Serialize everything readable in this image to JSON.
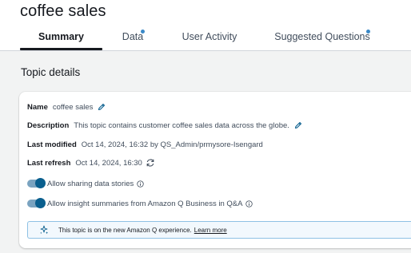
{
  "page": {
    "title": "coffee sales"
  },
  "tabs": [
    {
      "label": "Summary",
      "active": true,
      "indicator": false
    },
    {
      "label": "Data",
      "active": false,
      "indicator": true
    },
    {
      "label": "User Activity",
      "active": false,
      "indicator": false
    },
    {
      "label": "Suggested Questions",
      "active": false,
      "indicator": true
    }
  ],
  "topic_details": {
    "heading": "Topic details",
    "name_label": "Name",
    "name_value": "coffee sales",
    "description_label": "Description",
    "description_value": "This topic contains customer coffee sales data across the globe.",
    "last_modified_label": "Last modified",
    "last_modified_value": "Oct 14, 2024, 16:32 by QS_Admin/prmysore-Isengard",
    "last_refresh_label": "Last refresh",
    "last_refresh_value": "Oct 14, 2024, 16:30",
    "toggles": [
      {
        "label": "Allow sharing data stories",
        "on": true
      },
      {
        "label": "Allow insight summaries from Amazon Q Business in Q&A",
        "on": true
      }
    ],
    "banner": {
      "text": "This topic is on the new Amazon Q experience.",
      "link": "Learn more"
    }
  },
  "icons": {
    "edit": "pencil-icon",
    "refresh": "refresh-icon",
    "info": "info-icon",
    "amazon_q": "amazon-q-icon"
  },
  "colors": {
    "toggle_on": "#0a5f8e",
    "tab_indicator": "#3b89c7",
    "banner_bg": "#f2f8fd",
    "banner_border": "#8ec1e4"
  }
}
